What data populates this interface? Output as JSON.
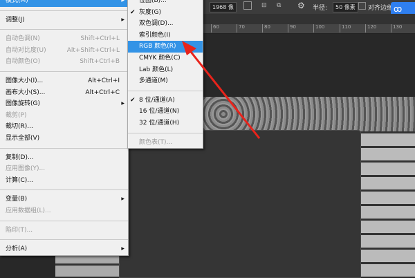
{
  "options_bar": {
    "size_value": "1968 像",
    "radius_label": "半径:",
    "radius_value": "50 像素",
    "align_label": "对齐边缘"
  },
  "ruler": {
    "ticks": [
      "60",
      "70",
      "80",
      "90",
      "100",
      "110",
      "120",
      "130"
    ]
  },
  "image_menu": {
    "items": [
      {
        "label": "模式(M)",
        "highlighted": true,
        "submenu": true
      },
      {
        "sep": true
      },
      {
        "label": "调整(J)",
        "submenu": true
      },
      {
        "sep": true
      },
      {
        "label": "自动色调(N)",
        "shortcut": "Shift+Ctrl+L",
        "disabled": true
      },
      {
        "label": "自动对比度(U)",
        "shortcut": "Alt+Shift+Ctrl+L",
        "disabled": true
      },
      {
        "label": "自动颜色(O)",
        "shortcut": "Shift+Ctrl+B",
        "disabled": true
      },
      {
        "sep": true
      },
      {
        "label": "图像大小(I)...",
        "shortcut": "Alt+Ctrl+I"
      },
      {
        "label": "画布大小(S)...",
        "shortcut": "Alt+Ctrl+C"
      },
      {
        "label": "图像旋转(G)",
        "submenu": true
      },
      {
        "label": "裁剪(P)",
        "disabled": true
      },
      {
        "label": "裁切(R)..."
      },
      {
        "label": "显示全部(V)"
      },
      {
        "sep": true
      },
      {
        "label": "复制(D)..."
      },
      {
        "label": "应用图像(Y)...",
        "disabled": true
      },
      {
        "label": "计算(C)..."
      },
      {
        "sep": true
      },
      {
        "label": "变量(B)",
        "submenu": true
      },
      {
        "label": "应用数据组(L)...",
        "disabled": true
      },
      {
        "sep": true
      },
      {
        "label": "陷印(T)...",
        "disabled": true
      },
      {
        "sep": true
      },
      {
        "label": "分析(A)",
        "submenu": true
      }
    ]
  },
  "mode_submenu": {
    "items": [
      {
        "label": "位图(B)..."
      },
      {
        "label": "灰度(G)",
        "checked": true
      },
      {
        "label": "双色调(D)..."
      },
      {
        "label": "索引颜色(I)"
      },
      {
        "label": "RGB 颜色(R)",
        "highlighted": true
      },
      {
        "label": "CMYK 颜色(C)"
      },
      {
        "label": "Lab 颜色(L)"
      },
      {
        "label": "多通道(M)"
      },
      {
        "sep": true
      },
      {
        "label": "8 位/通道(A)",
        "checked": true
      },
      {
        "label": "16 位/通道(N)"
      },
      {
        "label": "32 位/通道(H)"
      },
      {
        "sep": true
      },
      {
        "label": "颜色表(T)...",
        "disabled": true
      }
    ]
  },
  "colors": {
    "highlight": "#3393e6",
    "arrow": "#e8231b"
  }
}
